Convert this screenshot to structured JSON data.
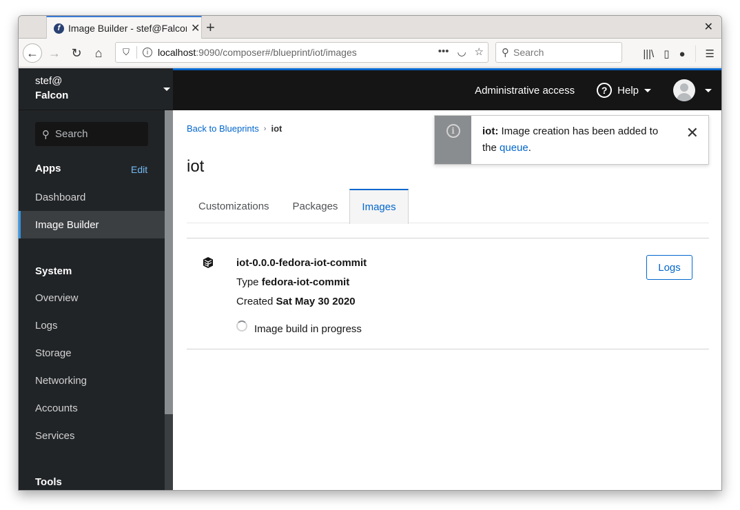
{
  "browser": {
    "tab_title": "Image Builder - stef@Falcon",
    "tab_close": "✕",
    "new_tab": "+",
    "window_close": "✕",
    "url_host": "localhost",
    "url_path": ":9090/composer#/blueprint/iot/images",
    "search_placeholder": "Search",
    "icons": {
      "back": "←",
      "forward": "→",
      "reload": "↻",
      "home": "⌂",
      "shield": "⛉",
      "info": "i",
      "more": "•••",
      "pocket": "◡",
      "star": "☆",
      "search": "⚲",
      "library": "|||\\",
      "sidebar": "▯",
      "account": "●",
      "menu": "☰"
    }
  },
  "host": {
    "user": "stef@",
    "name": "Falcon"
  },
  "masthead": {
    "admin_label": "Administrative access",
    "help_label": "Help",
    "help_icon": "?"
  },
  "sidebar": {
    "search_placeholder": "Search",
    "apps_heading": "Apps",
    "edit_label": "Edit",
    "apps": [
      {
        "label": "Dashboard",
        "active": false
      },
      {
        "label": "Image Builder",
        "active": true
      }
    ],
    "system_heading": "System",
    "system": [
      {
        "label": "Overview"
      },
      {
        "label": "Logs"
      },
      {
        "label": "Storage"
      },
      {
        "label": "Networking"
      },
      {
        "label": "Accounts"
      },
      {
        "label": "Services"
      }
    ],
    "tools_heading": "Tools"
  },
  "main": {
    "breadcrumb": {
      "back_label": "Back to Blueprints",
      "separator": "›",
      "current": "iot"
    },
    "title": "iot",
    "tabs": [
      {
        "label": "Customizations",
        "active": false
      },
      {
        "label": "Packages",
        "active": false
      },
      {
        "label": "Images",
        "active": true
      }
    ],
    "images": [
      {
        "name": "iot-0.0.0-fedora-iot-commit",
        "type_label": "Type",
        "type_value": "fedora-iot-commit",
        "created_label": "Created",
        "created_value": "Sat May 30 2020",
        "status": "Image build in progress",
        "logs_label": "Logs"
      }
    ]
  },
  "toast": {
    "prefix": "iot:",
    "message": "Image creation has been added to the",
    "link_text": "queue",
    "suffix": ".",
    "close": "✕",
    "info_icon": "i"
  }
}
